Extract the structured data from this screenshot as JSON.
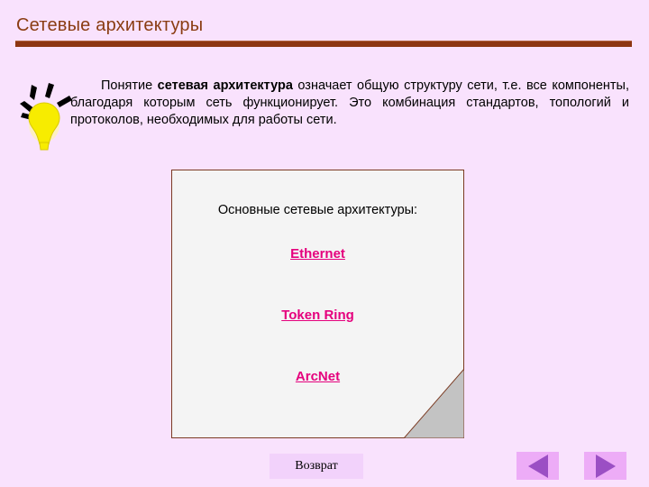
{
  "slide": {
    "title": "Сетевые архитектуры",
    "title_color": "#8a3c12",
    "rule_color": "#8d3512",
    "background_color": "#f9e2fd"
  },
  "intro": {
    "text_before_bold": "Понятие ",
    "bold_term": "сетевая архитектура",
    "text_after_bold": " означает общую структуру сети, т.е. все компоненты, благодаря которым сеть функционирует. Это комбинация стандартов, топологий и протоколов, необходимых для работы сети.",
    "icon": "lightbulb-idea-icon"
  },
  "card": {
    "heading": "Основные сетевые архитектуры:",
    "link_color": "#e5007d",
    "surface_color": "#f4f4f4",
    "border_color": "#7b3b23",
    "fold_color": "#c3c3c3",
    "links": [
      {
        "label": "Ethernet"
      },
      {
        "label": "Token Ring"
      },
      {
        "label": "ArcNet"
      }
    ]
  },
  "controls": {
    "return_label": "Возврат",
    "return_bg": "#f2d2fb",
    "prev_icon": "triangle-left-icon",
    "next_icon": "triangle-right-icon",
    "nav_bg": "#edacf7",
    "nav_arrow_color": "#9b4fc4"
  }
}
